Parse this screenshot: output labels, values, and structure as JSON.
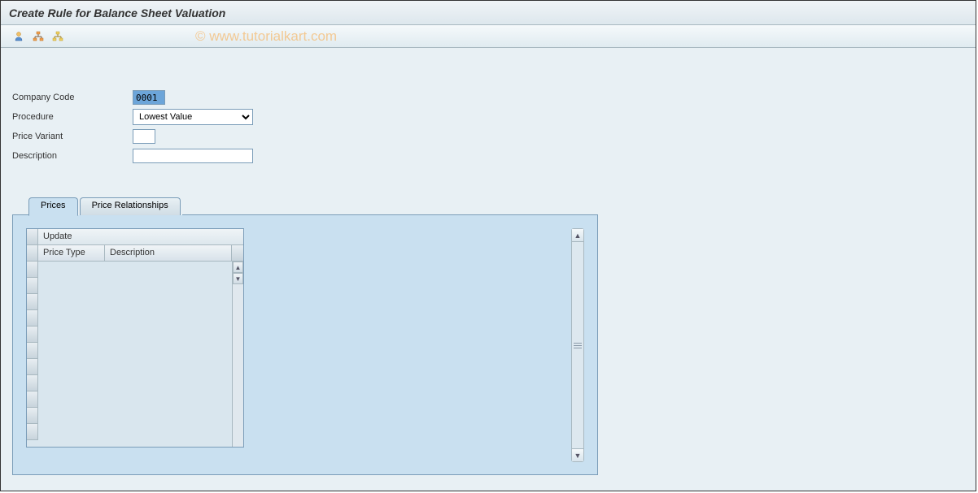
{
  "title": "Create Rule for Balance Sheet Valuation",
  "watermark": "© www.tutorialkart.com",
  "toolbar": {
    "icon1": "person-icon",
    "icon2": "org-icon",
    "icon3": "hierarchy-icon"
  },
  "form": {
    "company_code_label": "Company Code",
    "company_code_value": "0001",
    "procedure_label": "Procedure",
    "procedure_value": "Lowest Value",
    "price_variant_label": "Price Variant",
    "price_variant_value": "",
    "description_label": "Description",
    "description_value": ""
  },
  "tabs": {
    "prices": "Prices",
    "relationships": "Price Relationships"
  },
  "table": {
    "title": "Update",
    "col_price_type": "Price Type",
    "col_description": "Description"
  }
}
